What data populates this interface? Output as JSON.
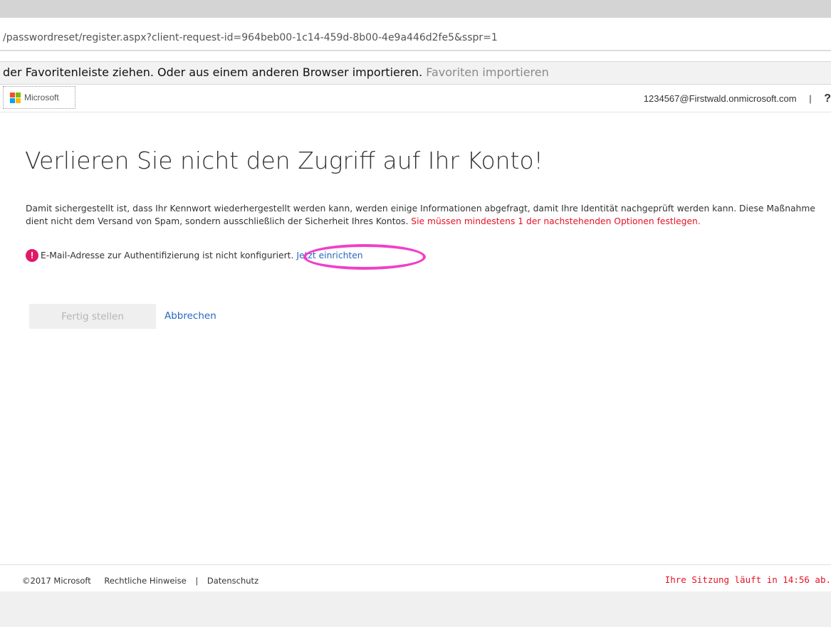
{
  "browser": {
    "url": "/passwordreset/register.aspx?client-request-id=964beb00-1c14-459d-8b00-4e9a446d2fe5&sspr=1",
    "favorites_text": "der Favoritenleiste ziehen. Oder aus einem anderen Browser importieren.",
    "favorites_link": "Favoriten importieren"
  },
  "header": {
    "brand": "Microsoft",
    "user_email": "1234567@Firstwald.onmicrosoft.com",
    "separator": "|",
    "help": "?"
  },
  "main": {
    "title": "Verlieren Sie nicht den Zugriff auf Ihr Konto!",
    "description": "Damit sichergestellt ist, dass Ihr Kennwort wiederhergestellt werden kann, werden einige Informationen abgefragt, damit Ihre Identität nachgeprüft werden kann. Diese Maßnahme dient nicht dem Versand von Spam, sondern ausschließlich der Sicherheit Ihres Kontos.",
    "requirement": "Sie müssen mindestens 1 der nachstehenden Optionen festlegen.",
    "alert_icon": "!",
    "alert_text": "E-Mail-Adresse zur Authentifizierung ist nicht konfiguriert.",
    "setup_link": "Jetzt einrichten",
    "finish_button": "Fertig stellen",
    "cancel_link": "Abbrechen"
  },
  "footer": {
    "copyright": "©2017 Microsoft",
    "legal": "Rechtliche Hinweise",
    "separator": "|",
    "privacy": "Datenschutz",
    "session": "Ihre Sitzung läuft in 14:56 ab."
  },
  "colors": {
    "link": "#2668c1",
    "error": "#e81123",
    "alert_icon": "#e0196a",
    "highlight": "#f040c8",
    "ms_red": "#f25022",
    "ms_green": "#7fba00",
    "ms_blue": "#00a4ef",
    "ms_yellow": "#ffb900"
  }
}
